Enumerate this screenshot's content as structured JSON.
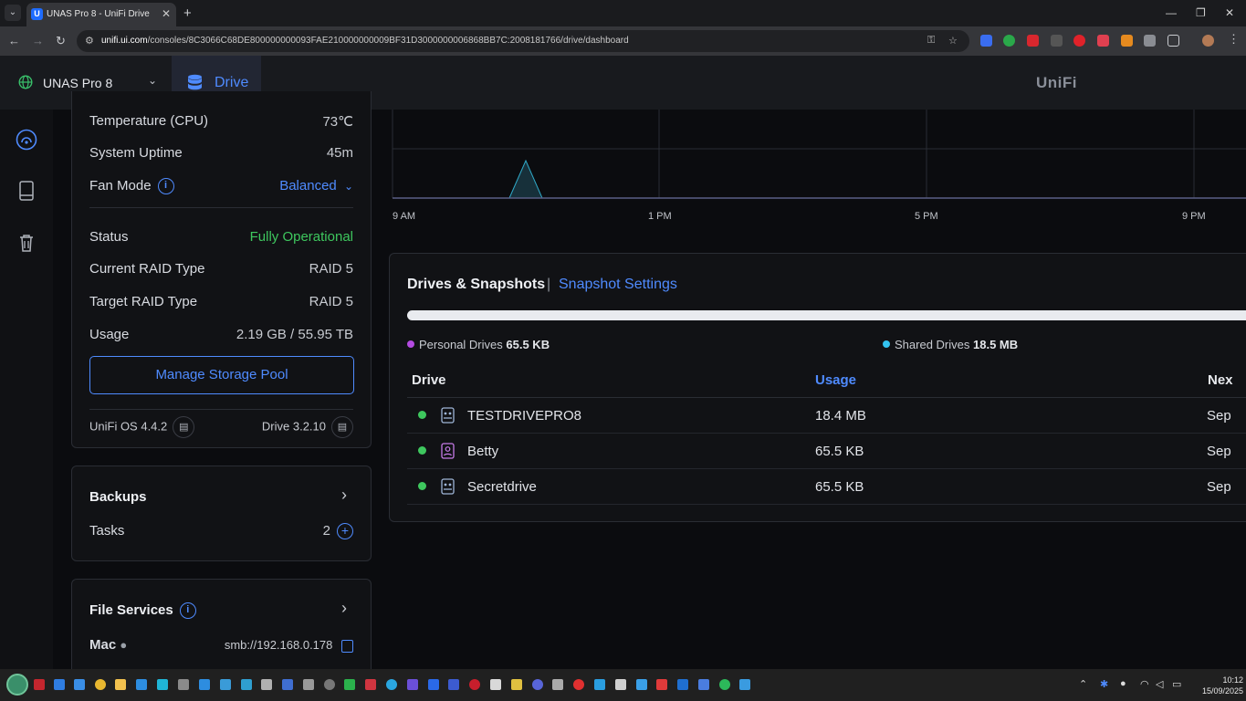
{
  "browser": {
    "tab_title": "UNAS Pro 8 - UniFi Drive",
    "tab_favicon": "U",
    "new_tab": "+",
    "url_host": "unifi.ui.com",
    "url_path": "/consoles/8C3066C68DE800000000093FAE210000000009BF31D3000000006868BB7C:2008181766/drive/dashboard"
  },
  "header": {
    "console_name": "UNAS Pro 8",
    "app_name": "Drive",
    "brand": "UniFi"
  },
  "system_card": {
    "temperature_label": "Temperature (CPU)",
    "temperature_value": "73℃",
    "uptime_label": "System Uptime",
    "uptime_value": "45m",
    "fan_label": "Fan Mode",
    "fan_value": "Balanced",
    "status_label": "Status",
    "status_value": "Fully Operational",
    "current_raid_label": "Current RAID Type",
    "current_raid_value": "RAID 5",
    "target_raid_label": "Target RAID Type",
    "target_raid_value": "RAID 5",
    "usage_label": "Usage",
    "usage_value": "2.19 GB / 55.95 TB",
    "manage_button": "Manage Storage Pool",
    "os_version": "UniFi OS 4.4.2",
    "drive_version": "Drive 3.2.10"
  },
  "backups_card": {
    "title": "Backups",
    "tasks_label": "Tasks",
    "tasks_count": "2"
  },
  "file_services_card": {
    "title": "File Services",
    "mac_label": "Mac",
    "mac_value": "smb://192.168.0.178"
  },
  "chart": {
    "x_ticks": [
      "9 AM",
      "1 PM",
      "5 PM",
      "9 PM"
    ]
  },
  "drives_panel": {
    "title": "Drives & Snapshots",
    "separator": "|",
    "settings_link": "Snapshot Settings",
    "personal_label": "Personal Drives",
    "personal_value": "65.5 KB",
    "shared_label": "Shared Drives",
    "shared_value": "18.5 MB",
    "columns": [
      "Drive",
      "Usage",
      "Nex"
    ],
    "rows": [
      {
        "name": "TESTDRIVEPRO8",
        "usage": "18.4 MB",
        "next": "Sep",
        "type": "shared-drive-icon"
      },
      {
        "name": "Betty",
        "usage": "65.5 KB",
        "next": "Sep",
        "type": "personal-drive-icon"
      },
      {
        "name": "Secretdrive",
        "usage": "65.5 KB",
        "next": "Sep",
        "type": "shared-drive-icon"
      }
    ]
  },
  "taskbar": {
    "time": "10:12",
    "date": "15/09/2025"
  },
  "colors": {
    "accent": "#4f8bff",
    "success": "#3ec75e",
    "personal": "#b44be1",
    "shared": "#33c3f0"
  }
}
